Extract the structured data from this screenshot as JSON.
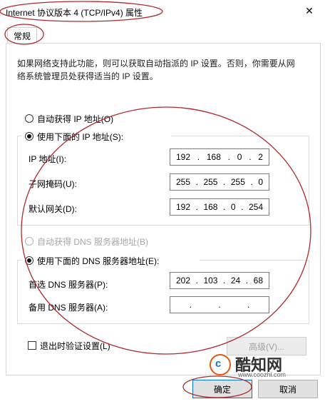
{
  "window": {
    "title": "Internet 协议版本 4 (TCP/IPv4) 属性",
    "close_glyph": "✕"
  },
  "tabs": [
    {
      "label": "常规"
    }
  ],
  "description": "如果网络支持此功能，则可以获取自动指派的 IP 设置。否则，你需要从网络系统管理员处获得适当的 IP 设置。",
  "ip_section": {
    "auto_label": "自动获得 IP 地址(O)",
    "manual_label": "使用下面的 IP 地址(S):",
    "selected": "manual",
    "fields": [
      {
        "label": "IP 地址(I):",
        "octets": [
          "192",
          "168",
          "0",
          "2"
        ]
      },
      {
        "label": "子网掩码(U):",
        "octets": [
          "255",
          "255",
          "255",
          "0"
        ]
      },
      {
        "label": "默认网关(D):",
        "octets": [
          "192",
          "168",
          "0",
          "254"
        ]
      }
    ]
  },
  "dns_section": {
    "auto_label": "自动获得 DNS 服务器地址(B)",
    "manual_label": "使用下面的 DNS 服务器地址(E):",
    "selected": "manual",
    "fields": [
      {
        "label": "首选 DNS 服务器(P):",
        "octets": [
          "202",
          "103",
          "24",
          "68"
        ]
      },
      {
        "label": "备用 DNS 服务器(A):",
        "octets": [
          "",
          "",
          "",
          ""
        ]
      }
    ]
  },
  "validate_on_exit": {
    "label": "退出时验证设置(L)",
    "checked": false
  },
  "buttons": {
    "advanced": "高级(V)...",
    "ok": "确定",
    "cancel": "取消"
  },
  "watermark": {
    "name": "酷知网",
    "url": "www.coozhi.com"
  },
  "colors": {
    "annotation": "#b02a2a",
    "focus": "#0078d7",
    "watermark": "#e05a12"
  }
}
